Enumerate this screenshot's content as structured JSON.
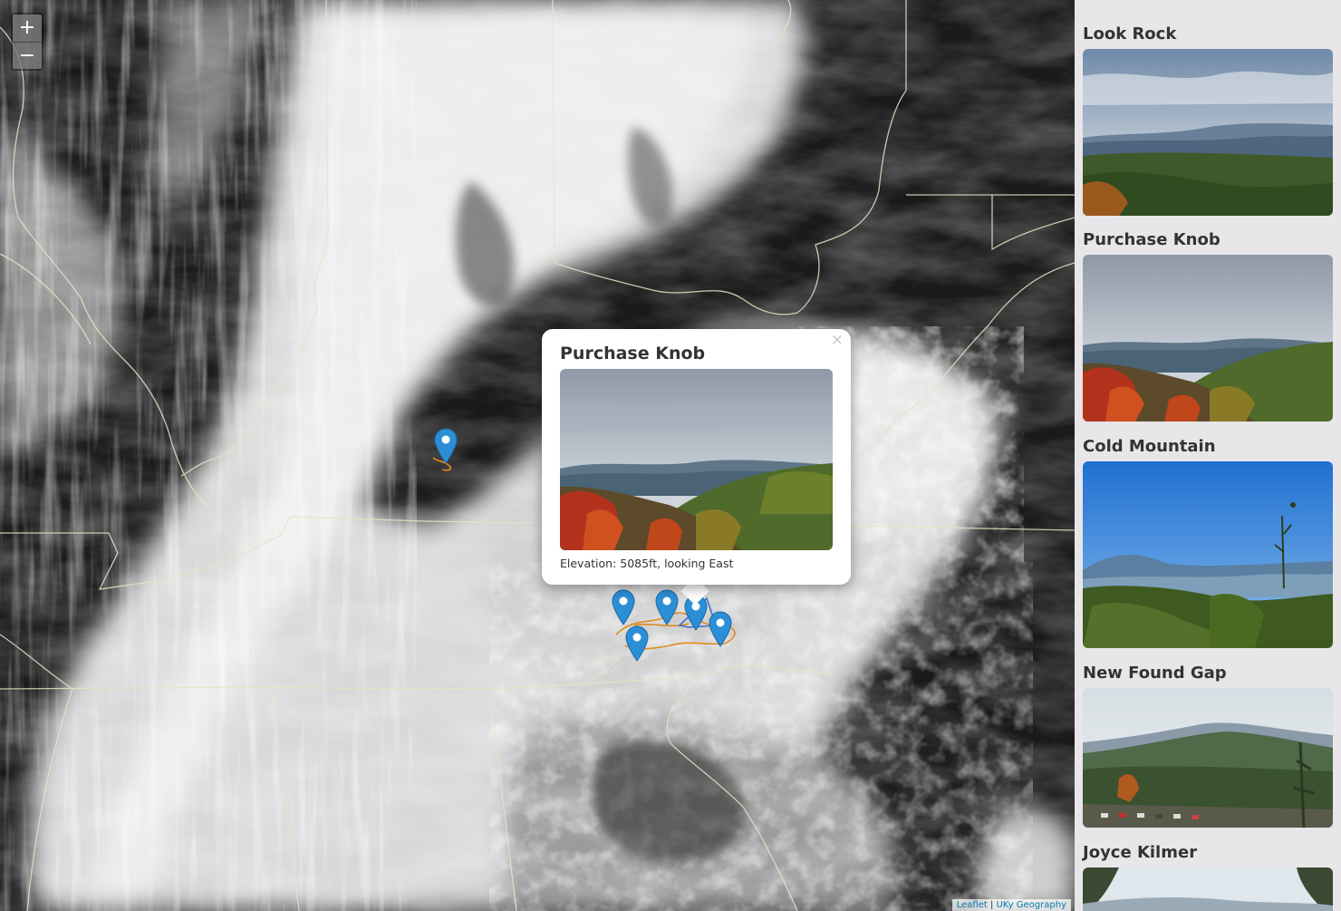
{
  "map": {
    "zoom_in_label": "+",
    "zoom_out_label": "−",
    "attribution": {
      "leaflet": "Leaflet",
      "separator": "|",
      "source": "UKy Geography"
    },
    "marker_color": "#2c8fd6",
    "trail_color": "#e08a1e"
  },
  "popup": {
    "title": "Purchase Knob",
    "caption": "Elevation: 5085ft, looking East",
    "close_label": "×"
  },
  "sidebar": {
    "locations": [
      {
        "name": "Look Rock",
        "photo": "mountain-vista"
      },
      {
        "name": "Purchase Knob",
        "photo": "autumn-ridge"
      },
      {
        "name": "Cold Mountain",
        "photo": "blue-sky-overlook"
      },
      {
        "name": "New Found Gap",
        "photo": "parking-overlook"
      },
      {
        "name": "Joyce Kilmer",
        "photo": "forest-canopy"
      }
    ]
  }
}
